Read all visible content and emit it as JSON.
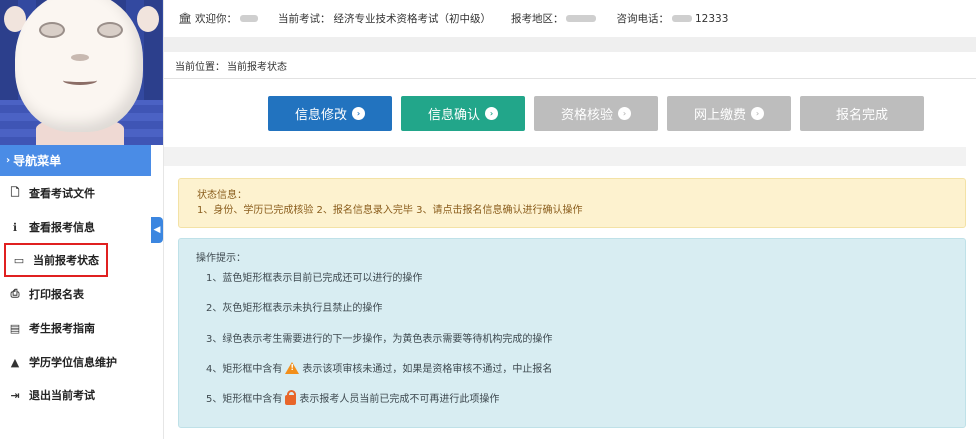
{
  "topbar": {
    "welcome_label": "欢迎你：",
    "exam_label": "当前考试：",
    "exam_value": "经济专业技术资格考试（初中级）",
    "region_label": "报考地区：",
    "phone_label": "咨询电话：",
    "phone_value": "12333"
  },
  "breadcrumb": {
    "label": "当前位置：",
    "value": "当前报考状态"
  },
  "nav": {
    "header": "导航菜单",
    "items": [
      {
        "label": "查看考试文件",
        "icon": "document-icon"
      },
      {
        "label": "查看报考信息",
        "icon": "info-icon"
      },
      {
        "label": "当前报考状态",
        "icon": "monitor-icon"
      },
      {
        "label": "打印报名表",
        "icon": "printer-icon"
      },
      {
        "label": "考生报考指南",
        "icon": "book-icon"
      },
      {
        "label": "学历学位信息维护",
        "icon": "graduation-cap-icon"
      },
      {
        "label": "退出当前考试",
        "icon": "exit-icon"
      }
    ]
  },
  "steps": [
    {
      "label": "信息修改",
      "state": "active-blue"
    },
    {
      "label": "信息确认",
      "state": "active-green"
    },
    {
      "label": "资格核验",
      "state": "disabled"
    },
    {
      "label": "网上缴费",
      "state": "disabled"
    },
    {
      "label": "报名完成",
      "state": "disabled"
    }
  ],
  "status": {
    "title": "状态信息：",
    "text": "1、身份、学历已完成核验 2、报名信息录入完毕 3、请点击报名信息确认进行确认操作"
  },
  "tips": {
    "title": "操作提示：",
    "items": [
      "1、蓝色矩形框表示目前已完成还可以进行的操作",
      "2、灰色矩形框表示未执行且禁止的操作",
      "3、绿色表示考生需要进行的下一步操作，为黄色表示需要等待机构完成的操作"
    ],
    "item4_before": "4、矩形框中含有",
    "item4_after": "表示该项审核未通过，如果是资格审核不通过，中止报名",
    "item5_before": "5、矩形框中含有",
    "item5_after": "表示报考人员当前已完成不可再进行此项操作"
  },
  "colors": {
    "nav_header": "#4a8ce6",
    "step_blue": "#2273bf",
    "step_green": "#22a68a",
    "step_disabled": "#bdbdbd",
    "status_bg": "#fdf2cf",
    "tips_bg": "#d8edf2",
    "active_outline": "#e02020"
  }
}
